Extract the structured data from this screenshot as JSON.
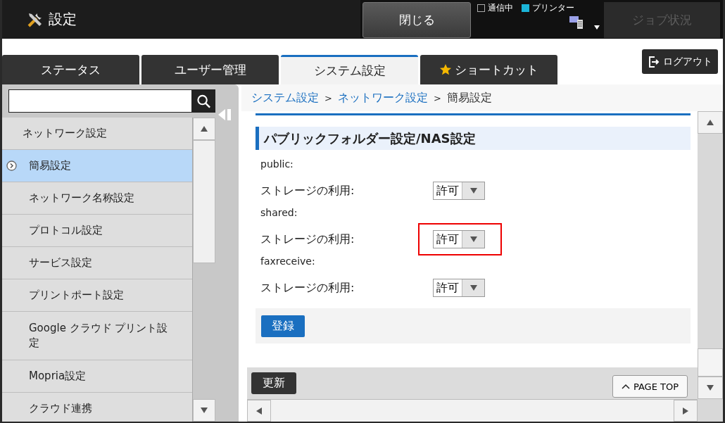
{
  "header": {
    "title": "設定",
    "close_button": "閉じる",
    "indicators": [
      {
        "label": "通信中",
        "on": false
      },
      {
        "label": "プリンター",
        "on": true
      }
    ],
    "job_status_button": {
      "label": "ジョブ状況",
      "disabled": true
    }
  },
  "tabs": [
    {
      "label": "ステータス",
      "selected": false,
      "kind": "plain"
    },
    {
      "label": "ユーザー管理",
      "selected": false,
      "kind": "plain"
    },
    {
      "label": "システム設定",
      "selected": true,
      "kind": "plain"
    },
    {
      "label": "ショートカット",
      "selected": false,
      "kind": "star"
    }
  ],
  "logout_button": "ログアウト",
  "sidebar": {
    "items": [
      {
        "label": "ネットワーク設定",
        "kind": "group",
        "selected": false
      },
      {
        "label": "簡易設定",
        "kind": "item",
        "selected": true
      },
      {
        "label": "ネットワーク名称設定",
        "kind": "item",
        "selected": false
      },
      {
        "label": "プロトコル設定",
        "kind": "item",
        "selected": false
      },
      {
        "label": "サービス設定",
        "kind": "item",
        "selected": false
      },
      {
        "label": "プリントポート設定",
        "kind": "item",
        "selected": false
      },
      {
        "label": "Google クラウド プリント設定",
        "kind": "item",
        "selected": false
      },
      {
        "label": "Mopria設定",
        "kind": "item",
        "selected": false
      },
      {
        "label": "クラウド連携",
        "kind": "item",
        "selected": false
      }
    ]
  },
  "breadcrumb": [
    {
      "label": "システム設定",
      "link": true,
      "separator": ">"
    },
    {
      "label": "ネットワーク設定",
      "link": true,
      "separator": ">"
    },
    {
      "label": "簡易設定",
      "link": false
    }
  ],
  "section": {
    "title": "パブリックフォルダー設定/NAS設定",
    "groups": [
      {
        "name": "public:",
        "label": "ストレージの利用:",
        "value": "許可",
        "highlighted": false
      },
      {
        "name": "shared:",
        "label": "ストレージの利用:",
        "value": "許可",
        "highlighted": true
      },
      {
        "name": "faxreceive:",
        "label": "ストレージの利用:",
        "value": "許可",
        "highlighted": false
      }
    ],
    "submit_button": "登録"
  },
  "refresh_button": "更新",
  "page_top_button": "PAGE TOP"
}
